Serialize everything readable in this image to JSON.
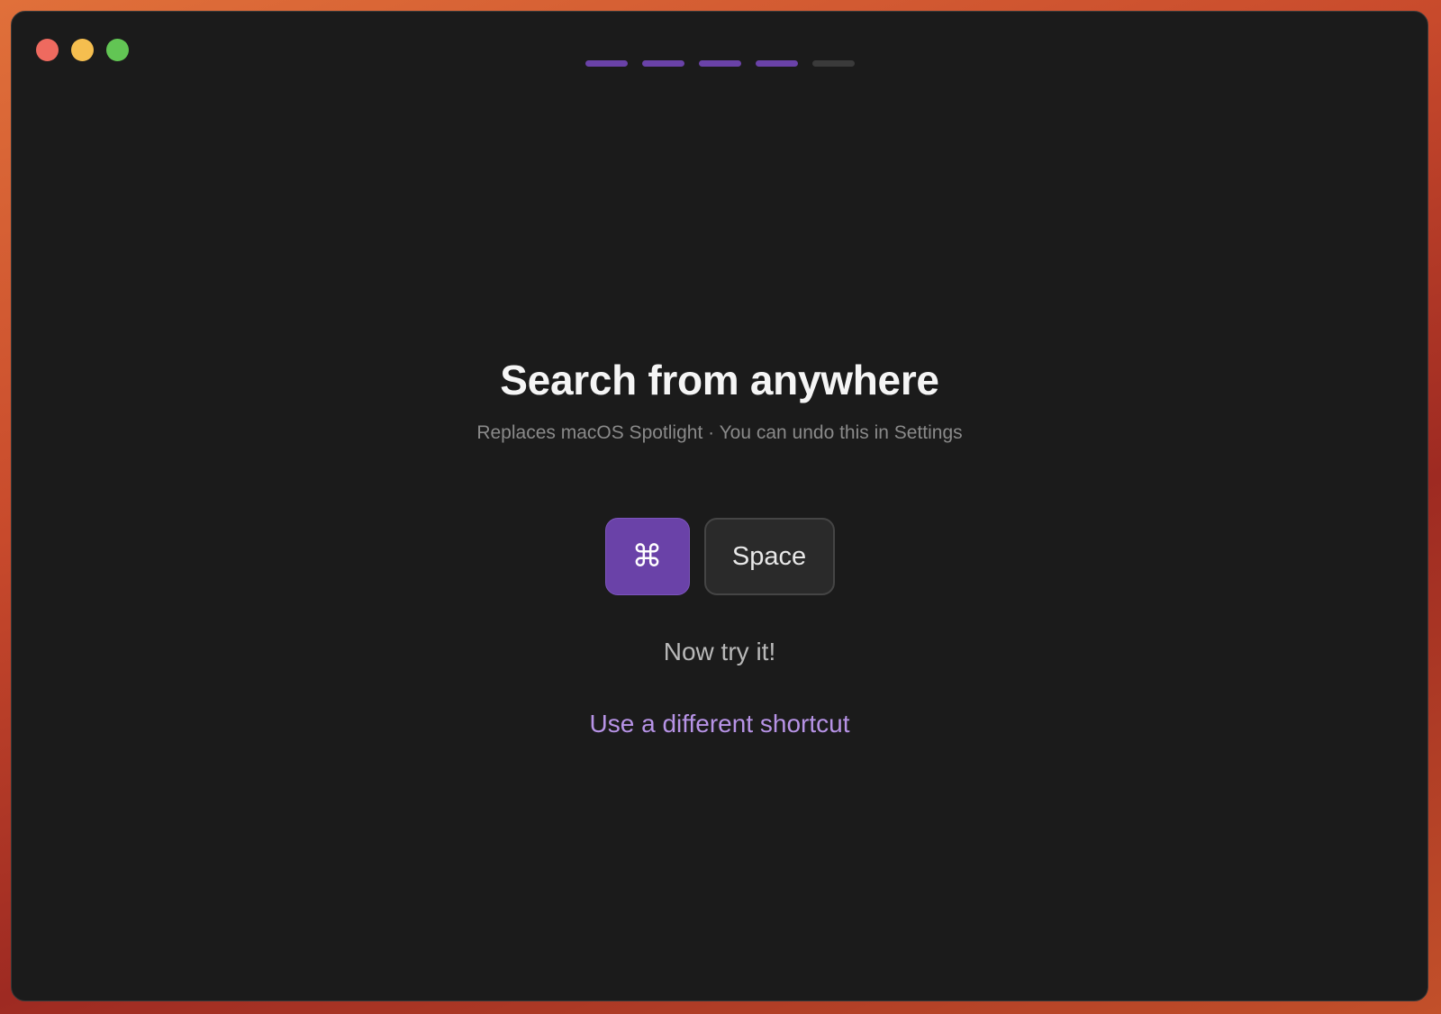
{
  "window": {
    "controls": [
      {
        "name": "close",
        "color": "#ee6a5f"
      },
      {
        "name": "minimize",
        "color": "#f5be4f"
      },
      {
        "name": "maximize",
        "color": "#62c554"
      }
    ]
  },
  "onboarding": {
    "total_steps": 5,
    "current_step": 4,
    "active_color": "#6a42a8",
    "inactive_color": "#3a3a3a"
  },
  "main": {
    "title": "Search from anywhere",
    "subtitle": "Replaces macOS Spotlight · You can undo this in Settings",
    "shortcut": {
      "modifier_icon": "command-icon",
      "modifier": "⌘",
      "key": "Space"
    },
    "hint": "Now try it!",
    "change_shortcut_label": "Use a different shortcut"
  }
}
